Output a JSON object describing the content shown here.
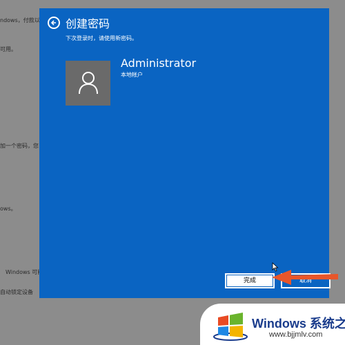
{
  "background": {
    "fragments": [
      "ndows，付款以外",
      "可用。",
      "加一个密码，您",
      "ows。",
      "Windows 可能",
      "自动锁定设备"
    ]
  },
  "dialog": {
    "title": "创建密码",
    "subtitle": "下次登录时，请使用新密码。",
    "account": {
      "name": "Administrator",
      "type": "本地帐户"
    },
    "buttons": {
      "finish": "完成",
      "cancel": "取消"
    },
    "bg_color": "#0a64c2"
  },
  "watermark": {
    "title": "Windows 系统之家",
    "url": "www.bjjmlv.com"
  }
}
